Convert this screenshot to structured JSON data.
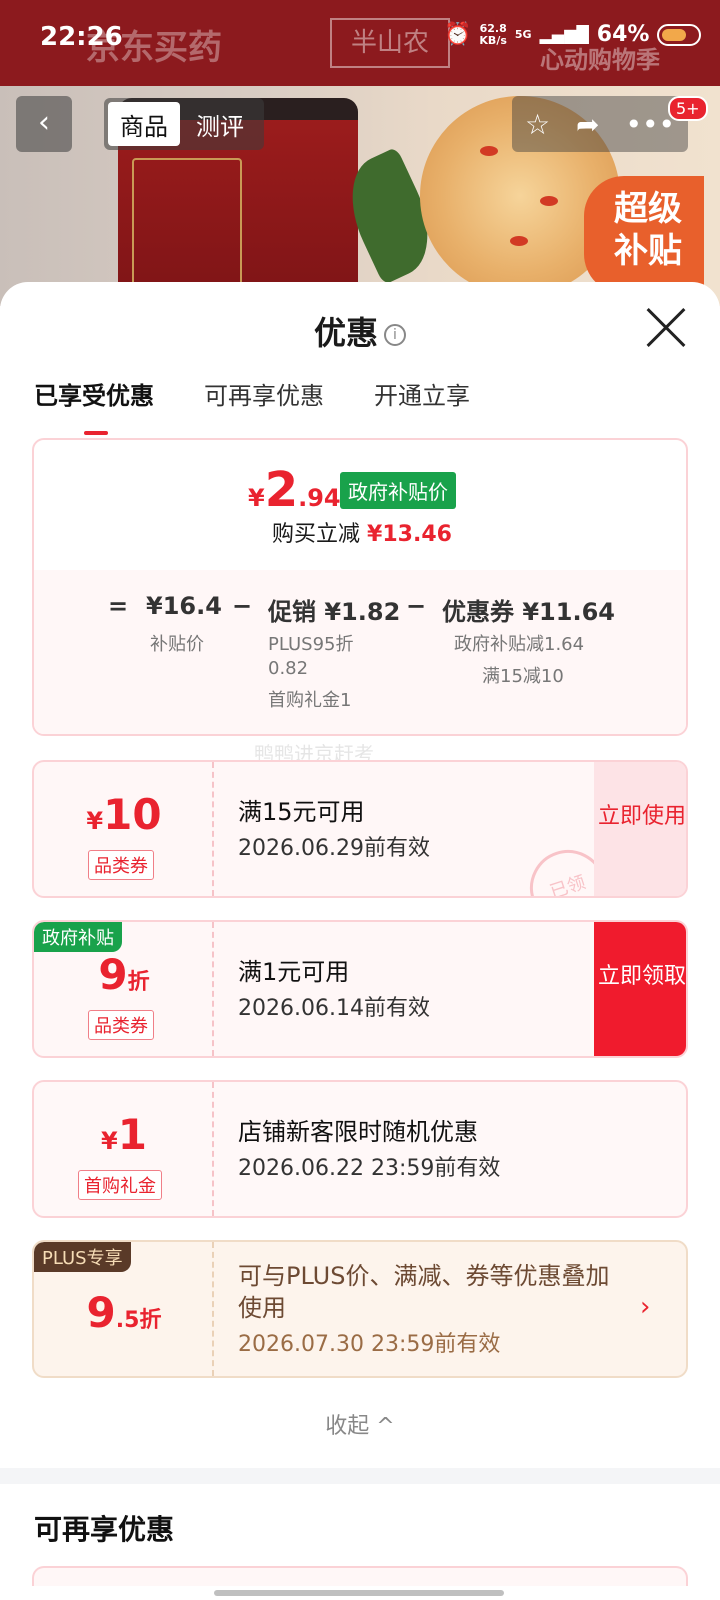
{
  "status_bar": {
    "time": "22:26",
    "net_speed_value": "62.8",
    "net_speed_unit": "KB/s",
    "network": "5G",
    "battery": "64%"
  },
  "header_bg": {
    "brand": "京东买药",
    "shop_logo": "半山农",
    "promo": "心动购物季"
  },
  "nav": {
    "back_icon": "chevron-left-icon",
    "tabs": [
      "商品",
      "测评"
    ],
    "active_tab": "商品",
    "badge": "5+",
    "super_subsidy": "超级补贴"
  },
  "sheet": {
    "title": "优惠",
    "tabs": [
      "已享受优惠",
      "可再享优惠",
      "开通立享"
    ],
    "summary": {
      "price_symbol": "¥",
      "price_int": "2",
      "price_dec": ".94",
      "gov_tag": "政府补贴价",
      "reduce_label": "购买立减",
      "reduce_amount": "¥13.46",
      "eq": "=",
      "minus": "−",
      "subsidy_price": "¥16.4",
      "subsidy_label": "补贴价",
      "promo_label": "促销 ¥1.82",
      "promo_detail1": "PLUS95折",
      "promo_detail2": "0.82",
      "promo_detail3": "首购礼金1",
      "coupon_label": "优惠券 ¥11.64",
      "coupon_detail1": "政府补贴减1.64",
      "coupon_detail2": "满15减10"
    },
    "watermark": "鸭鸭进京赶考",
    "coupons": [
      {
        "symbol": "¥",
        "amount": "10",
        "suffix": "",
        "type": "品类券",
        "condition": "满15元可用",
        "valid": "2026.06.29前有效",
        "button": "立即使用",
        "stamp": "已领"
      },
      {
        "corner": "政府补贴",
        "symbol": "",
        "amount": "9",
        "suffix": "折",
        "type": "品类券",
        "condition": "满1元可用",
        "valid": "2026.06.14前有效",
        "button": "立即领取"
      },
      {
        "symbol": "¥",
        "amount": "1",
        "suffix": "",
        "type": "首购礼金",
        "condition": "店铺新客限时随机优惠",
        "valid": "2026.06.22 23:59前有效"
      },
      {
        "corner": "PLUS专享",
        "symbol": "",
        "amount": "9",
        "suffix": ".5折",
        "condition": "可与PLUS价、满减、券等优惠叠加使用",
        "valid": "2026.07.30 23:59前有效"
      }
    ],
    "collapse": "收起 ^",
    "more_title": "可再享优惠"
  }
}
